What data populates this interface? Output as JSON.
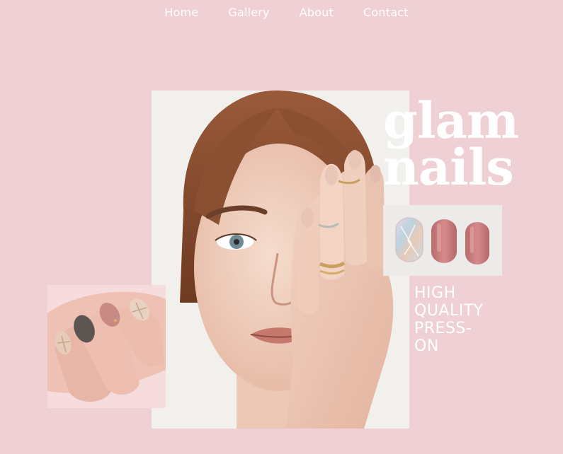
{
  "nav": {
    "items": [
      {
        "label": "Home"
      },
      {
        "label": "Gallery"
      },
      {
        "label": "About"
      },
      {
        "label": "Contact"
      }
    ]
  },
  "brand": {
    "line1": "glam",
    "line2": "nails"
  },
  "tagline": {
    "lines": [
      "HIGH",
      "QUALITY",
      "PRESS-",
      "ON"
    ]
  },
  "colors": {
    "background": "#efd0d5",
    "text": "#ffffff",
    "nail_pink": "#c9797c",
    "nail_holo": "#c9dbe6"
  },
  "images": {
    "hero": "woman-covering-eye-with-manicured-hand",
    "thumbnail": "hand-with-plaid-and-gray-nail-art",
    "swatch": "three-press-on-nail-samples"
  }
}
